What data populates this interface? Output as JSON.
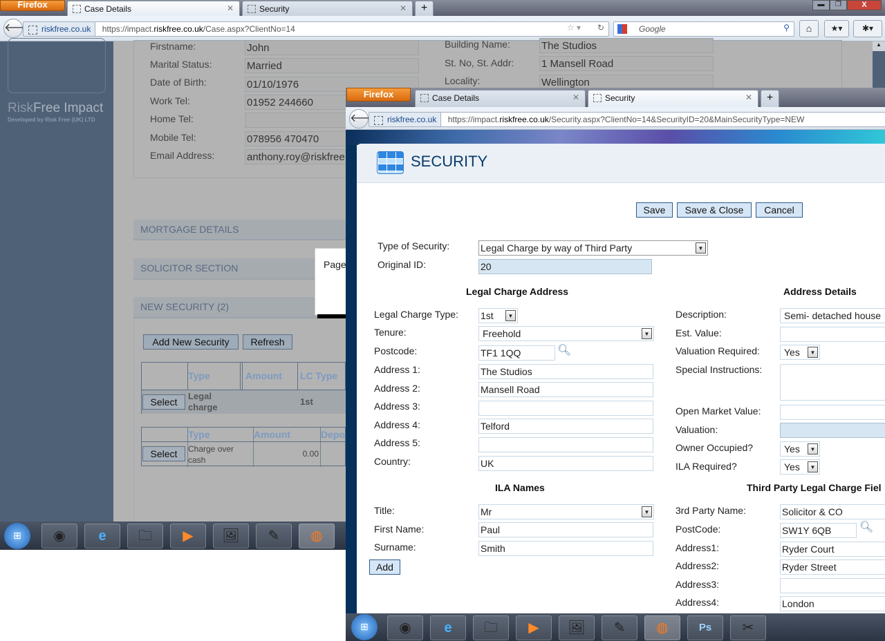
{
  "back_window": {
    "firefox_label": "Firefox",
    "tabs": [
      {
        "label": "Case Details"
      },
      {
        "label": "Security"
      }
    ],
    "new_tab": "+",
    "identity": "riskfree.co.uk",
    "url_prefix": "https://impact.",
    "url_domain": "riskfree.co.uk",
    "url_path": "/Case.aspx?ClientNo=14",
    "search_placeholder": "Google",
    "brand": {
      "risk": "Risk",
      "free_impact": "Free Impact",
      "tagline": "Developed by Risk Free (UK) LTD"
    },
    "personal": [
      {
        "label": "Firstname:",
        "value": "John"
      },
      {
        "label": "Marital Status:",
        "value": "Married"
      },
      {
        "label": "Date of Birth:",
        "value": "01/10/1976"
      },
      {
        "label": "Work Tel:",
        "value": "01952 244660"
      },
      {
        "label": "Home Tel:",
        "value": ""
      },
      {
        "label": "Mobile Tel:",
        "value": "078956 470470"
      },
      {
        "label": "Email Address:",
        "value": "anthony.roy@riskfree."
      }
    ],
    "address": [
      {
        "label": "Building Name:",
        "value": "The Studios"
      },
      {
        "label": "St. No, St. Addr:",
        "value": "1 Mansell Road"
      },
      {
        "label": "Locality:",
        "value": "Wellington"
      }
    ],
    "sections": [
      "MORTGAGE DETAILS",
      "SOLICITOR SECTION",
      "NEW SECURITY (2)"
    ],
    "add_new_security": "Add New Security",
    "refresh": "Refresh",
    "popup_text": "Page",
    "table1": {
      "headers": [
        "Type",
        "Amount",
        "LC Type"
      ],
      "row": {
        "select": "Select",
        "type": "Legal charge",
        "amount": "",
        "lc_type": "1st"
      }
    },
    "table2": {
      "headers": [
        "Type",
        "Amount",
        "Depo"
      ],
      "row": {
        "select": "Select",
        "type": "Charge over cash",
        "amount": "0.00"
      }
    }
  },
  "front_window": {
    "firefox_label": "Firefox",
    "tabs": [
      {
        "label": "Case Details"
      },
      {
        "label": "Security"
      }
    ],
    "new_tab": "+",
    "identity": "riskfree.co.uk",
    "url_prefix": "https://impact.",
    "url_domain": "riskfree.co.uk",
    "url_path": "/Security.aspx?ClientNo=14&SecurityID=20&MainSecurityType=NEW",
    "page_title": "SECURITY",
    "buttons": {
      "save": "Save",
      "save_close": "Save & Close",
      "cancel": "Cancel",
      "add": "Add"
    },
    "type_of_security": {
      "label": "Type of Security:",
      "value": "Legal Charge by way of Third Party"
    },
    "original_id": {
      "label": "Original ID:",
      "value": "20"
    },
    "headings": {
      "legal": "Legal Charge Address",
      "address": "Address Details",
      "ila": "ILA Names",
      "third": "Third Party Legal Charge Fiel"
    },
    "legal": {
      "lc_type": {
        "label": "Legal Charge Type:",
        "value": "1st"
      },
      "tenure": {
        "label": "Tenure:",
        "value": "Freehold"
      },
      "postcode": {
        "label": "Postcode:",
        "value": "TF1 1QQ"
      },
      "address1": {
        "label": "Address 1:",
        "value": "The Studios"
      },
      "address2": {
        "label": "Address 2:",
        "value": "Mansell Road"
      },
      "address3": {
        "label": "Address 3:",
        "value": ""
      },
      "address4": {
        "label": "Address 4:",
        "value": "Telford"
      },
      "address5": {
        "label": "Address 5:",
        "value": ""
      },
      "country": {
        "label": "Country:",
        "value": "UK"
      }
    },
    "details": {
      "description": {
        "label": "Description:",
        "value": "Semi- detached house"
      },
      "est_value": {
        "label": "Est. Value:",
        "value": ""
      },
      "valuation_required": {
        "label": "Valuation Required:",
        "value": "Yes"
      },
      "special": {
        "label": "Special Instructions:",
        "value": ""
      },
      "omv": {
        "label": "Open Market Value:",
        "value": ""
      },
      "valuation": {
        "label": "Valuation:",
        "value": ""
      },
      "owner_occupied": {
        "label": "Owner Occupied?",
        "value": "Yes"
      },
      "ila_required": {
        "label": "ILA Required?",
        "value": "Yes"
      }
    },
    "ila": {
      "title": {
        "label": "Title:",
        "value": "Mr"
      },
      "first": {
        "label": "First Name:",
        "value": "Paul"
      },
      "surname": {
        "label": "Surname:",
        "value": "Smith"
      }
    },
    "third": {
      "name": {
        "label": "3rd Party Name:",
        "value": "Solicitor & CO"
      },
      "postcode": {
        "label": "PostCode:",
        "value": "SW1Y 6QB"
      },
      "address1": {
        "label": "Address1:",
        "value": "Ryder Court"
      },
      "address2": {
        "label": "Address2:",
        "value": "Ryder Street"
      },
      "address3": {
        "label": "Address3:",
        "value": ""
      },
      "address4": {
        "label": "Address4:",
        "value": "London"
      }
    }
  },
  "colors": {
    "accent": "#0a3a6a",
    "button_bg": "#d6e6f6",
    "readonly_bg": "#d6e6f2",
    "firefox_orange": "#e67e1e"
  }
}
